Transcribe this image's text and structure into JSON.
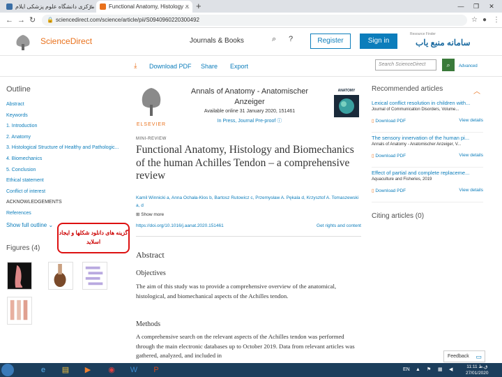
{
  "browser": {
    "tabs": [
      {
        "label": "کتابخانه مرکزی دانشگاه علوم پزشکی ایلام",
        "close": "×"
      },
      {
        "label": "Functional Anatomy, Histology ...",
        "close": "×"
      }
    ],
    "new_tab": "+",
    "window_controls": [
      "—",
      "❐",
      "✕"
    ],
    "url": "sciencedirect.com/science/article/pii/S0940960220300492"
  },
  "header": {
    "brand": "ScienceDirect",
    "journals_books": "Journals & Books",
    "register": "Register",
    "sign_in": "Sign in",
    "institution_logo_text": "سامانه منبع یاب",
    "institution_logo_sub": "Resource Finder"
  },
  "toolbar": {
    "download_pdf": "Download PDF",
    "share": "Share",
    "export": "Export",
    "search_placeholder": "Search ScienceDirect",
    "advanced": "Advanced"
  },
  "outline": {
    "title": "Outline",
    "items": [
      "Abstract",
      "Keywords",
      "1. Introduction",
      "2. Anatomy",
      "3. Histological Structure of Healthy and Pathologic...",
      "4. Biomechanics",
      "5. Conclusion",
      "Ethical statement",
      "Conflict of interest",
      "ACKNOWLEDGEMENTS",
      "References"
    ],
    "show_full": "Show full outline"
  },
  "figures": {
    "title": "Figures (4)"
  },
  "callout": {
    "text": "گزینه های دانلود شکلها و ایجاد اسلاید"
  },
  "article": {
    "journal": "Annals of Anatomy - Anatomischer Anzeiger",
    "available": "Available online 31 January 2020, 151461",
    "in_press": "In Press, Journal Pre-proof",
    "publisher": "ELSEVIER",
    "cover_title": "ANATOMY",
    "type": "MINI-REVIEW",
    "title": "Functional Anatomy, Histology and Biomechanics of the human Achilles Tendon – a comprehensive review",
    "authors": "Kamil Winnicki a, Anna Ochała-Kłos b, Bartosz Rutowicz c, Przemysław A. Pękala d, Krzysztof A. Tomaszewski a, d",
    "show_more": "Show more",
    "doi": "https://doi.org/10.1016/j.aanat.2020.151461",
    "rights": "Get rights and content",
    "abstract_heading": "Abstract",
    "objectives_heading": "Objectives",
    "objectives_text": "The aim of this study was to provide a comprehensive overview of the anatomical, histological, and biomechanical aspects of the Achilles tendon.",
    "methods_heading": "Methods",
    "methods_text": "A comprehensive search on the relevant aspects of the Achilles tendon was performed through the main electronic databases up to October 2019. Data from relevant articles was gathered, analyzed, and included in"
  },
  "recommended": {
    "title": "Recommended articles",
    "items": [
      {
        "title": "Lexical conflict resolution in children with...",
        "journal": "Journal of Communication Disorders, Volume...",
        "pdf": "Download PDF",
        "view": "View details"
      },
      {
        "title": "The sensory innervation of the human pi...",
        "journal": "Annals of Anatomy - Anatomischer Anzeiger, V...",
        "pdf": "Download PDF",
        "view": "View details"
      },
      {
        "title": "Effect of partial and complete replaceme...",
        "journal": "Aquaculture and Fisheries, 2019",
        "pdf": "Download PDF",
        "view": "View details"
      }
    ]
  },
  "citing": {
    "title": "Citing articles (0)"
  },
  "feedback": {
    "label": "Feedback"
  },
  "taskbar": {
    "lang": "EN",
    "time": "11:11 ق.ظ",
    "date": "27/01/2020"
  },
  "colors": {
    "accent": "#0c7dbb",
    "brand_orange": "#e9711c",
    "callout_red": "#dd1111",
    "taskbar": "#1c3e5c"
  }
}
